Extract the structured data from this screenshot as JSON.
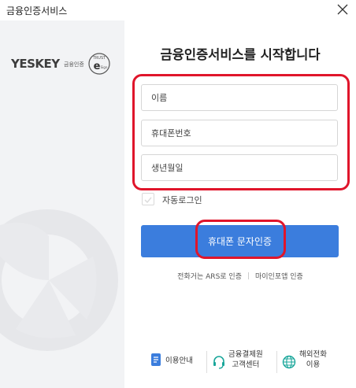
{
  "window": {
    "title": "금융인증서비스"
  },
  "brand": {
    "logo_text": "YESKEY",
    "logo_sub": "금융인증",
    "trust_top": "TRUST",
    "trust_e": "e",
    "trust_sign": "Sign"
  },
  "main": {
    "heading": "금융인증서비스를 시작합니다",
    "fields": {
      "name_placeholder": "이름",
      "phone_placeholder": "휴대폰번호",
      "birth_placeholder": "생년월일"
    },
    "auto_login_label": "자동로그인",
    "sms_button_label": "휴대폰 문자인증",
    "link_ars": "전화거는 ARS로 인증",
    "link_mydata": "마이인포앱 인증"
  },
  "footer": {
    "usage": "이용안내",
    "support_line1": "금융결제원",
    "support_line2": "고객센터",
    "overseas_line1": "해외전화",
    "overseas_line2": "이용"
  },
  "colors": {
    "accent": "#3b7ddd",
    "highlight": "#e0152b",
    "sidebar_bg": "#f2f3f5"
  },
  "icons": {
    "close": "close-icon",
    "usage": "document-icon",
    "support": "headset-icon",
    "overseas": "globe-icon"
  }
}
